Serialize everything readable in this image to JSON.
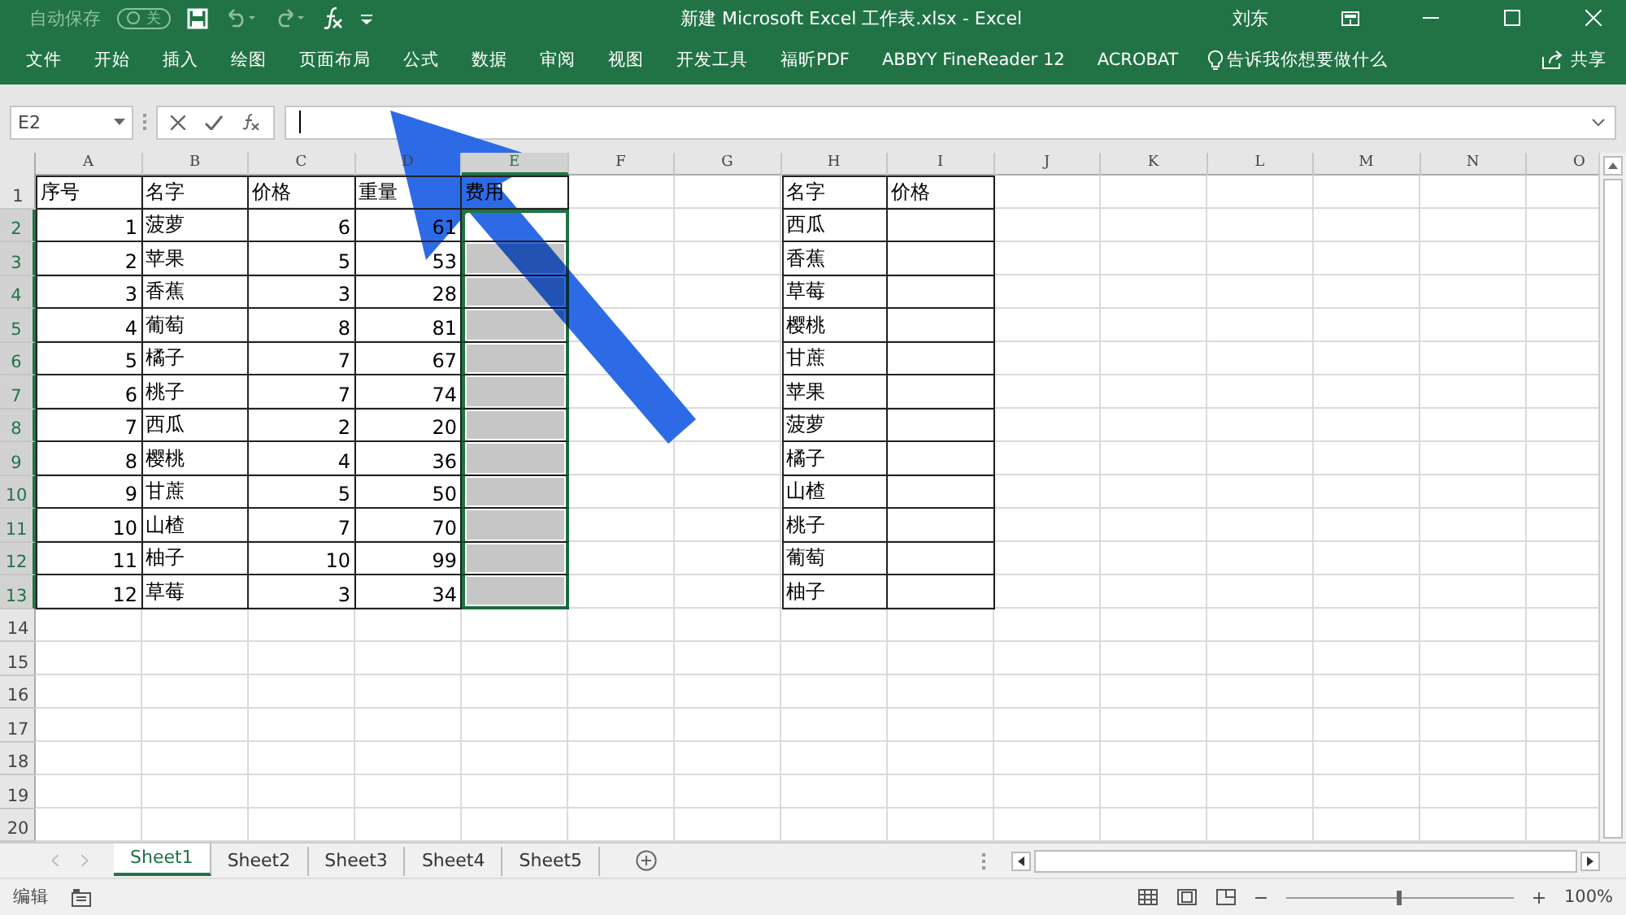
{
  "title_bar": {
    "autosave_label": "自动保存",
    "autosave_state": "关",
    "autosave_on": false,
    "title": "新建 Microsoft Excel 工作表.xlsx  -  Excel",
    "user": "刘东"
  },
  "ribbon_tabs": [
    "文件",
    "开始",
    "插入",
    "绘图",
    "页面布局",
    "公式",
    "数据",
    "审阅",
    "视图",
    "开发工具",
    "福昕PDF",
    "ABBYY FineReader 12",
    "ACROBAT"
  ],
  "tell_me": "告诉我你想要做什么",
  "share": "共享",
  "formula_bar": {
    "name_box": "E2"
  },
  "columns": [
    {
      "label": "A",
      "selected": false
    },
    {
      "label": "B",
      "selected": false
    },
    {
      "label": "C",
      "selected": false
    },
    {
      "label": "D",
      "selected": false
    },
    {
      "label": "E",
      "selected": true
    },
    {
      "label": "F",
      "selected": false
    },
    {
      "label": "G",
      "selected": false
    },
    {
      "label": "H",
      "selected": false
    },
    {
      "label": "I",
      "selected": false
    },
    {
      "label": "J",
      "selected": false
    },
    {
      "label": "K",
      "selected": false
    },
    {
      "label": "L",
      "selected": false
    },
    {
      "label": "M",
      "selected": false
    },
    {
      "label": "N",
      "selected": false
    },
    {
      "label": "O",
      "selected": false
    }
  ],
  "rows": [
    {
      "label": "1",
      "selected": false
    },
    {
      "label": "2",
      "selected": true
    },
    {
      "label": "3",
      "selected": true
    },
    {
      "label": "4",
      "selected": true
    },
    {
      "label": "5",
      "selected": true
    },
    {
      "label": "6",
      "selected": true
    },
    {
      "label": "7",
      "selected": true
    },
    {
      "label": "8",
      "selected": true
    },
    {
      "label": "9",
      "selected": true
    },
    {
      "label": "10",
      "selected": true
    },
    {
      "label": "11",
      "selected": true
    },
    {
      "label": "12",
      "selected": true
    },
    {
      "label": "13",
      "selected": true
    },
    {
      "label": "14",
      "selected": false
    },
    {
      "label": "15",
      "selected": false
    },
    {
      "label": "16",
      "selected": false
    },
    {
      "label": "17",
      "selected": false
    },
    {
      "label": "18",
      "selected": false
    },
    {
      "label": "19",
      "selected": false
    },
    {
      "label": "20",
      "selected": false
    }
  ],
  "tables": [
    {
      "rows": [
        [
          {
            "text": "序号",
            "kind": "text",
            "shaded": false,
            "selected": false
          },
          {
            "text": "名字",
            "kind": "text",
            "shaded": false,
            "selected": false
          },
          {
            "text": "价格",
            "kind": "text",
            "shaded": false,
            "selected": false
          },
          {
            "text": "重量",
            "kind": "text",
            "shaded": false,
            "selected": false
          },
          {
            "text": "费用",
            "kind": "text",
            "shaded": false,
            "selected": false
          }
        ],
        [
          {
            "text": "1",
            "kind": "number",
            "shaded": false,
            "selected": false
          },
          {
            "text": "菠萝",
            "kind": "text",
            "shaded": false,
            "selected": false
          },
          {
            "text": "6",
            "kind": "number",
            "shaded": false,
            "selected": false
          },
          {
            "text": "61",
            "kind": "number",
            "shaded": false,
            "selected": false
          },
          {
            "kind": "text",
            "shaded": false,
            "selected": true
          }
        ],
        [
          {
            "text": "2",
            "kind": "number",
            "shaded": false,
            "selected": false
          },
          {
            "text": "苹果",
            "kind": "text",
            "shaded": false,
            "selected": false
          },
          {
            "text": "5",
            "kind": "number",
            "shaded": false,
            "selected": false
          },
          {
            "text": "53",
            "kind": "number",
            "shaded": false,
            "selected": false
          },
          {
            "kind": "text",
            "shaded": true,
            "selected": true
          }
        ],
        [
          {
            "text": "3",
            "kind": "number",
            "shaded": false,
            "selected": false
          },
          {
            "text": "香蕉",
            "kind": "text",
            "shaded": false,
            "selected": false
          },
          {
            "text": "3",
            "kind": "number",
            "shaded": false,
            "selected": false
          },
          {
            "text": "28",
            "kind": "number",
            "shaded": false,
            "selected": false
          },
          {
            "kind": "text",
            "shaded": true,
            "selected": true
          }
        ],
        [
          {
            "text": "4",
            "kind": "number",
            "shaded": false,
            "selected": false
          },
          {
            "text": "葡萄",
            "kind": "text",
            "shaded": false,
            "selected": false
          },
          {
            "text": "8",
            "kind": "number",
            "shaded": false,
            "selected": false
          },
          {
            "text": "81",
            "kind": "number",
            "shaded": false,
            "selected": false
          },
          {
            "kind": "text",
            "shaded": true,
            "selected": true
          }
        ],
        [
          {
            "text": "5",
            "kind": "number",
            "shaded": false,
            "selected": false
          },
          {
            "text": "橘子",
            "kind": "text",
            "shaded": false,
            "selected": false
          },
          {
            "text": "7",
            "kind": "number",
            "shaded": false,
            "selected": false
          },
          {
            "text": "67",
            "kind": "number",
            "shaded": false,
            "selected": false
          },
          {
            "kind": "text",
            "shaded": true,
            "selected": true
          }
        ],
        [
          {
            "text": "6",
            "kind": "number",
            "shaded": false,
            "selected": false
          },
          {
            "text": "桃子",
            "kind": "text",
            "shaded": false,
            "selected": false
          },
          {
            "text": "7",
            "kind": "number",
            "shaded": false,
            "selected": false
          },
          {
            "text": "74",
            "kind": "number",
            "shaded": false,
            "selected": false
          },
          {
            "kind": "text",
            "shaded": true,
            "selected": true
          }
        ],
        [
          {
            "text": "7",
            "kind": "number",
            "shaded": false,
            "selected": false
          },
          {
            "text": "西瓜",
            "kind": "text",
            "shaded": false,
            "selected": false
          },
          {
            "text": "2",
            "kind": "number",
            "shaded": false,
            "selected": false
          },
          {
            "text": "20",
            "kind": "number",
            "shaded": false,
            "selected": false
          },
          {
            "kind": "text",
            "shaded": true,
            "selected": true
          }
        ],
        [
          {
            "text": "8",
            "kind": "number",
            "shaded": false,
            "selected": false
          },
          {
            "text": "樱桃",
            "kind": "text",
            "shaded": false,
            "selected": false
          },
          {
            "text": "4",
            "kind": "number",
            "shaded": false,
            "selected": false
          },
          {
            "text": "36",
            "kind": "number",
            "shaded": false,
            "selected": false
          },
          {
            "kind": "text",
            "shaded": true,
            "selected": true
          }
        ],
        [
          {
            "text": "9",
            "kind": "number",
            "shaded": false,
            "selected": false
          },
          {
            "text": "甘蔗",
            "kind": "text",
            "shaded": false,
            "selected": false
          },
          {
            "text": "5",
            "kind": "number",
            "shaded": false,
            "selected": false
          },
          {
            "text": "50",
            "kind": "number",
            "shaded": false,
            "selected": false
          },
          {
            "kind": "text",
            "shaded": true,
            "selected": true
          }
        ],
        [
          {
            "text": "10",
            "kind": "number",
            "shaded": false,
            "selected": false
          },
          {
            "text": "山楂",
            "kind": "text",
            "shaded": false,
            "selected": false
          },
          {
            "text": "7",
            "kind": "number",
            "shaded": false,
            "selected": false
          },
          {
            "text": "70",
            "kind": "number",
            "shaded": false,
            "selected": false
          },
          {
            "kind": "text",
            "shaded": true,
            "selected": true
          }
        ],
        [
          {
            "text": "11",
            "kind": "number",
            "shaded": false,
            "selected": false
          },
          {
            "text": "柚子",
            "kind": "text",
            "shaded": false,
            "selected": false
          },
          {
            "text": "10",
            "kind": "number",
            "shaded": false,
            "selected": false
          },
          {
            "text": "99",
            "kind": "number",
            "shaded": false,
            "selected": false
          },
          {
            "kind": "text",
            "shaded": true,
            "selected": true
          }
        ],
        [
          {
            "text": "12",
            "kind": "number",
            "shaded": false,
            "selected": false
          },
          {
            "text": "草莓",
            "kind": "text",
            "shaded": false,
            "selected": false
          },
          {
            "text": "3",
            "kind": "number",
            "shaded": false,
            "selected": false
          },
          {
            "text": "34",
            "kind": "number",
            "shaded": false,
            "selected": false
          },
          {
            "kind": "text",
            "shaded": true,
            "selected": true
          }
        ]
      ]
    },
    {
      "rows": [
        [
          {
            "text": "名字",
            "kind": "text",
            "shaded": false,
            "selected": false
          },
          {
            "text": "价格",
            "kind": "text",
            "shaded": false,
            "selected": false
          }
        ],
        [
          {
            "text": "西瓜",
            "kind": "text",
            "shaded": false,
            "selected": false
          },
          {
            "kind": "text",
            "shaded": false,
            "selected": false
          }
        ],
        [
          {
            "text": "香蕉",
            "kind": "text",
            "shaded": false,
            "selected": false
          },
          {
            "kind": "text",
            "shaded": false,
            "selected": false
          }
        ],
        [
          {
            "text": "草莓",
            "kind": "text",
            "shaded": false,
            "selected": false
          },
          {
            "kind": "text",
            "shaded": false,
            "selected": false
          }
        ],
        [
          {
            "text": "樱桃",
            "kind": "text",
            "shaded": false,
            "selected": false
          },
          {
            "kind": "text",
            "shaded": false,
            "selected": false
          }
        ],
        [
          {
            "text": "甘蔗",
            "kind": "text",
            "shaded": false,
            "selected": false
          },
          {
            "kind": "text",
            "shaded": false,
            "selected": false
          }
        ],
        [
          {
            "text": "苹果",
            "kind": "text",
            "shaded": false,
            "selected": false
          },
          {
            "kind": "text",
            "shaded": false,
            "selected": false
          }
        ],
        [
          {
            "text": "菠萝",
            "kind": "text",
            "shaded": false,
            "selected": false
          },
          {
            "kind": "text",
            "shaded": false,
            "selected": false
          }
        ],
        [
          {
            "text": "橘子",
            "kind": "text",
            "shaded": false,
            "selected": false
          },
          {
            "kind": "text",
            "shaded": false,
            "selected": false
          }
        ],
        [
          {
            "text": "山楂",
            "kind": "text",
            "shaded": false,
            "selected": false
          },
          {
            "kind": "text",
            "shaded": false,
            "selected": false
          }
        ],
        [
          {
            "text": "桃子",
            "kind": "text",
            "shaded": false,
            "selected": false
          },
          {
            "kind": "text",
            "shaded": false,
            "selected": false
          }
        ],
        [
          {
            "text": "葡萄",
            "kind": "text",
            "shaded": false,
            "selected": false
          },
          {
            "kind": "text",
            "shaded": false,
            "selected": false
          }
        ],
        [
          {
            "text": "柚子",
            "kind": "text",
            "shaded": false,
            "selected": false
          },
          {
            "kind": "text",
            "shaded": false,
            "selected": false
          }
        ]
      ]
    }
  ],
  "sheet_tabs": [
    {
      "label": "Sheet1",
      "selected": true
    },
    {
      "label": "Sheet2",
      "selected": false
    },
    {
      "label": "Sheet3",
      "selected": false
    },
    {
      "label": "Sheet4",
      "selected": false
    },
    {
      "label": "Sheet5",
      "selected": false
    }
  ],
  "status_bar": {
    "mode": "编辑",
    "zoom": {
      "level": 0.5,
      "reading": "100%"
    }
  }
}
